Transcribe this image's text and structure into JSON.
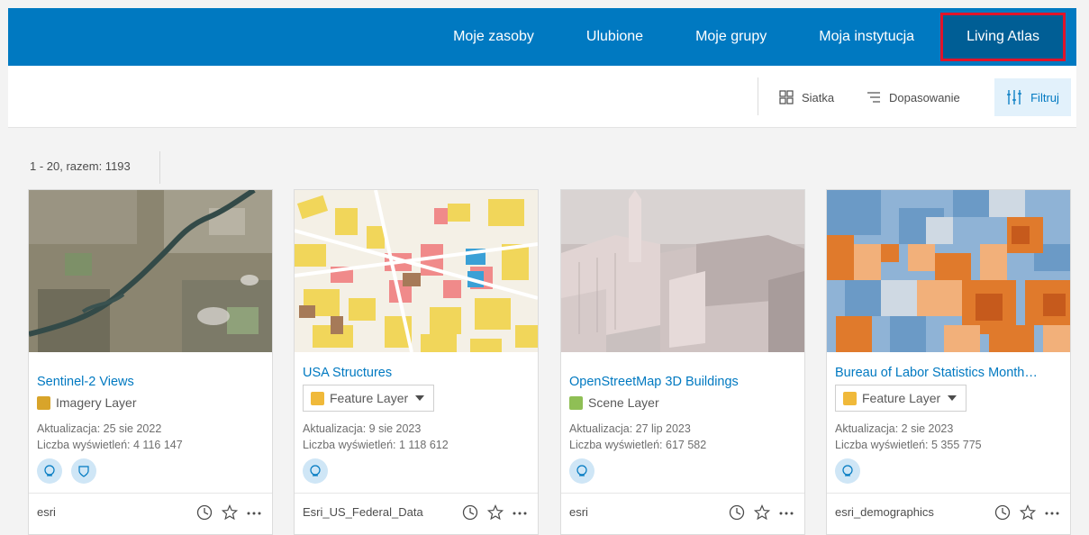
{
  "nav": {
    "tabs": [
      "Moje zasoby",
      "Ulubione",
      "Moje grupy",
      "Moja instytucja",
      "Living Atlas"
    ],
    "active": "Living Atlas"
  },
  "toolbar": {
    "grid_label": "Siatka",
    "sort_label": "Dopasowanie",
    "filter_label": "Filtruj"
  },
  "results": {
    "count_label": "1 - 20, razem: 1193"
  },
  "cards": [
    {
      "title": "Sentinel-2 Views",
      "type": "Imagery Layer",
      "updated": "Aktualizacja: 25 sie 2022",
      "views": "Liczba wyświetleń: 4 116 147",
      "owner": "esri"
    },
    {
      "title": "USA Structures",
      "type": "Feature Layer",
      "updated": "Aktualizacja: 9 sie 2023",
      "views": "Liczba wyświetleń: 1 118 612",
      "owner": "Esri_US_Federal_Data"
    },
    {
      "title": "OpenStreetMap 3D Buildings",
      "type": "Scene Layer",
      "updated": "Aktualizacja: 27 lip 2023",
      "views": "Liczba wyświetleń: 617 582",
      "owner": "esri"
    },
    {
      "title": "Bureau of Labor Statistics Month…",
      "type": "Feature Layer",
      "updated": "Aktualizacja: 2 sie 2023",
      "views": "Liczba wyświetleń: 5 355 775",
      "owner": "esri_demographics"
    }
  ],
  "colors": {
    "brand_blue": "#0079c1",
    "active_outline": "#e0142a",
    "badge_bg": "#cfe6f6"
  }
}
